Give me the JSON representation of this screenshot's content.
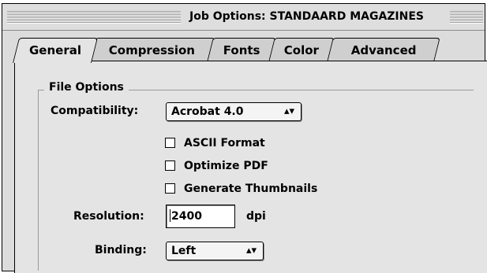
{
  "window": {
    "title": "Job Options: STANDAARD MAGAZINES"
  },
  "tabs": [
    {
      "label": "General",
      "active": true
    },
    {
      "label": "Compression",
      "active": false
    },
    {
      "label": "Fonts",
      "active": false
    },
    {
      "label": "Color",
      "active": false
    },
    {
      "label": "Advanced",
      "active": false
    }
  ],
  "file_options": {
    "group_title": "File Options",
    "compatibility_label": "Compatibility:",
    "compatibility_value": "Acrobat 4.0",
    "checkboxes": [
      {
        "label": "ASCII Format",
        "checked": false
      },
      {
        "label": "Optimize PDF",
        "checked": false
      },
      {
        "label": "Generate Thumbnails",
        "checked": false
      }
    ],
    "resolution_label": "Resolution:",
    "resolution_value": "2400",
    "resolution_unit": "dpi",
    "binding_label": "Binding:",
    "binding_value": "Left"
  },
  "icons": {
    "popup_arrows": "updown-arrows-icon"
  }
}
